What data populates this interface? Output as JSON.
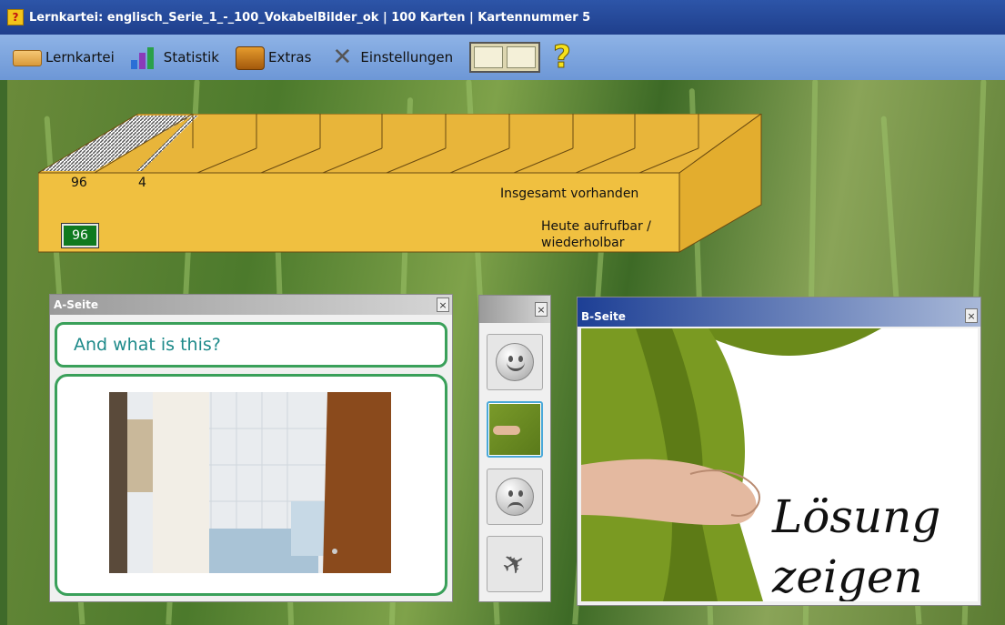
{
  "window": {
    "title": "Lernkartei: englisch_Serie_1_-_100_VokabelBilder_ok | 100 Karten | Kartennummer 5",
    "app_icon": "question-card-icon"
  },
  "toolbar": {
    "items": [
      {
        "label": "Lernkartei",
        "icon": "card-box-icon"
      },
      {
        "label": "Statistik",
        "icon": "statistics-icon"
      },
      {
        "label": "Extras",
        "icon": "suitcase-icon"
      },
      {
        "label": "Einstellungen",
        "icon": "tools-icon"
      }
    ],
    "cards_icon": "cards-icon",
    "help_icon": "help-icon",
    "help_glyph": "?"
  },
  "cardbox": {
    "compartment_counts": [
      "96",
      "4"
    ],
    "total_label": "Insgesamt vorhanden",
    "due_label_line1": "Heute aufrufbar /",
    "due_label_line2": "wiederholbar",
    "due_count": "96"
  },
  "panel_a": {
    "title": "A-Seite",
    "close": "×",
    "question": "And what is this?",
    "image": "bathroom-photo"
  },
  "panel_mid": {
    "close": "×",
    "buttons": [
      "smiley-happy-icon",
      "card-thumbnail",
      "smiley-sad-icon",
      "plane-icon"
    ]
  },
  "panel_b": {
    "title": "B-Seite",
    "close": "×",
    "solution_line1": "Lösung",
    "solution_line2": "zeigen",
    "image": "curtain-photo"
  },
  "colors": {
    "titlebar": "#1f3f8c",
    "toolbar": "#7aa2dc",
    "box": "#f0c040",
    "accent_green": "#3aa05a",
    "due_badge": "#0f7a1f"
  }
}
